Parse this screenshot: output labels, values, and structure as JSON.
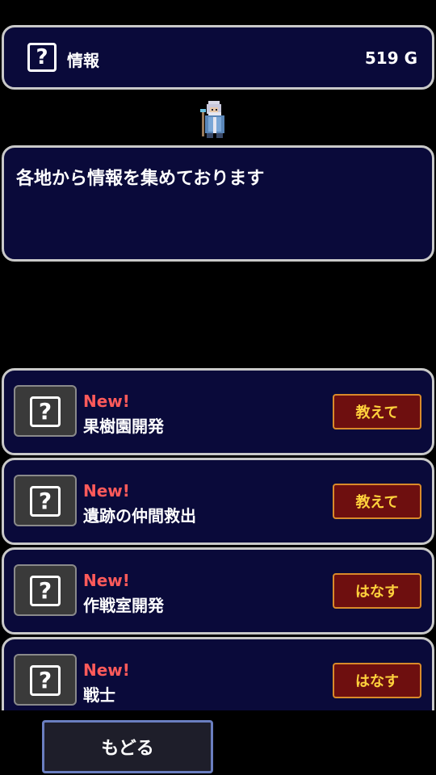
{
  "header": {
    "icon": "question-mark-icon",
    "title": "情報",
    "gold": "519 G"
  },
  "npc": {
    "icon": "sage-sprite"
  },
  "dialog": {
    "text": "各地から情報を集めております"
  },
  "items": [
    {
      "badge": "New!",
      "title": "果樹園開発",
      "button": "教えて",
      "icon": "question-mark-icon"
    },
    {
      "badge": "New!",
      "title": "遺跡の仲間救出",
      "button": "教えて",
      "icon": "question-mark-icon"
    },
    {
      "badge": "New!",
      "title": "作戦室開発",
      "button": "はなす",
      "icon": "question-mark-icon"
    },
    {
      "badge": "New!",
      "title": "戦士",
      "button": "はなす",
      "icon": "question-mark-icon"
    }
  ],
  "footer": {
    "back_label": "もどる"
  },
  "colors": {
    "panel_bg": "#0a0a3a",
    "panel_border": "#c9c9c9",
    "new_label": "#ff5a5a",
    "action_bg": "#6e0f0f",
    "action_text": "#ffd23c"
  }
}
